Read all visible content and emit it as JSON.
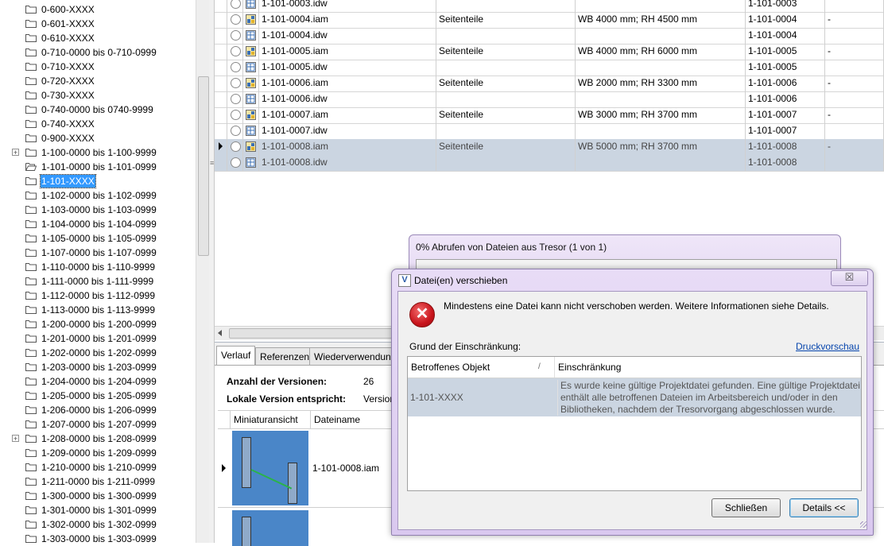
{
  "tree": {
    "items": [
      {
        "label": "0-600-XXXX",
        "expander": false
      },
      {
        "label": "0-601-XXXX",
        "expander": false
      },
      {
        "label": "0-610-XXXX",
        "expander": false
      },
      {
        "label": "0-710-0000 bis 0-710-0999",
        "expander": false
      },
      {
        "label": "0-710-XXXX",
        "expander": false
      },
      {
        "label": "0-720-XXXX",
        "expander": false
      },
      {
        "label": "0-730-XXXX",
        "expander": false
      },
      {
        "label": "0-740-0000 bis 0740-9999",
        "expander": false
      },
      {
        "label": "0-740-XXXX",
        "expander": false
      },
      {
        "label": "0-900-XXXX",
        "expander": false
      },
      {
        "label": "1-100-0000 bis 1-100-9999",
        "expander": true
      },
      {
        "label": "1-101-0000 bis 1-101-0999",
        "expander": false,
        "open": true
      },
      {
        "label": "1-101-XXXX",
        "expander": false,
        "selected": true
      },
      {
        "label": "1-102-0000 bis 1-102-0999",
        "expander": false
      },
      {
        "label": "1-103-0000 bis 1-103-0999",
        "expander": false
      },
      {
        "label": "1-104-0000 bis 1-104-0999",
        "expander": false
      },
      {
        "label": "1-105-0000 bis 1-105-0999",
        "expander": false
      },
      {
        "label": "1-107-0000 bis 1-107-0999",
        "expander": false
      },
      {
        "label": "1-110-0000 bis 1-110-9999",
        "expander": false
      },
      {
        "label": "1-111-0000 bis 1-111-9999",
        "expander": false
      },
      {
        "label": "1-112-0000 bis 1-112-0999",
        "expander": false
      },
      {
        "label": "1-113-0000 bis 1-113-9999",
        "expander": false
      },
      {
        "label": "1-200-0000 bis 1-200-0999",
        "expander": false
      },
      {
        "label": "1-201-0000 bis 1-201-0999",
        "expander": false
      },
      {
        "label": "1-202-0000 bis 1-202-0999",
        "expander": false
      },
      {
        "label": "1-203-0000 bis 1-203-0999",
        "expander": false
      },
      {
        "label": "1-204-0000 bis 1-204-0999",
        "expander": false
      },
      {
        "label": "1-205-0000 bis 1-205-0999",
        "expander": false
      },
      {
        "label": "1-206-0000 bis 1-206-0999",
        "expander": false
      },
      {
        "label": "1-207-0000 bis 1-207-0999",
        "expander": false
      },
      {
        "label": "1-208-0000 bis 1-208-0999",
        "expander": true
      },
      {
        "label": "1-209-0000 bis 1-209-0999",
        "expander": false
      },
      {
        "label": "1-210-0000 bis 1-210-0999",
        "expander": false
      },
      {
        "label": "1-211-0000 bis 1-211-0999",
        "expander": false
      },
      {
        "label": "1-300-0000 bis 1-300-0999",
        "expander": false
      },
      {
        "label": "1-301-0000 bis 1-301-0999",
        "expander": false
      },
      {
        "label": "1-302-0000 bis 1-302-0999",
        "expander": false
      },
      {
        "label": "1-303-0000 bis 1-303-0999",
        "expander": false
      }
    ]
  },
  "files": {
    "rows": [
      {
        "name": "1-101-0003.idw",
        "category": "",
        "size": "",
        "number": "1-101-0003",
        "extra": "",
        "type": "idw"
      },
      {
        "name": "1-101-0004.iam",
        "category": "Seitenteile",
        "size": "WB 4000 mm;  RH 4500 mm",
        "number": "1-101-0004",
        "extra": "-",
        "type": "iam"
      },
      {
        "name": "1-101-0004.idw",
        "category": "",
        "size": "",
        "number": "1-101-0004",
        "extra": "",
        "type": "idw"
      },
      {
        "name": "1-101-0005.iam",
        "category": "Seitenteile",
        "size": "WB 4000 mm;  RH 6000 mm",
        "number": "1-101-0005",
        "extra": "-",
        "type": "iam"
      },
      {
        "name": "1-101-0005.idw",
        "category": "",
        "size": "",
        "number": "1-101-0005",
        "extra": "",
        "type": "idw"
      },
      {
        "name": "1-101-0006.iam",
        "category": "Seitenteile",
        "size": "WB 2000 mm;  RH 3300 mm",
        "number": "1-101-0006",
        "extra": "-",
        "type": "iam"
      },
      {
        "name": "1-101-0006.idw",
        "category": "",
        "size": "",
        "number": "1-101-0006",
        "extra": "",
        "type": "idw"
      },
      {
        "name": "1-101-0007.iam",
        "category": "Seitenteile",
        "size": "WB 3000 mm; RH 3700 mm",
        "number": "1-101-0007",
        "extra": "-",
        "type": "iam"
      },
      {
        "name": "1-101-0007.idw",
        "category": "",
        "size": "",
        "number": "1-101-0007",
        "extra": "",
        "type": "idw"
      },
      {
        "name": "1-101-0008.iam",
        "category": "Seitenteile",
        "size": "WB 5000 mm;  RH 3700 mm",
        "number": "1-101-0008",
        "extra": "-",
        "type": "iam",
        "highlight": true,
        "current": true
      },
      {
        "name": "1-101-0008.idw",
        "category": "",
        "size": "",
        "number": "1-101-0008",
        "extra": "",
        "type": "idw",
        "highlight": true
      }
    ]
  },
  "details": {
    "tabs": [
      "Verlauf",
      "Referenzen",
      "Wiederverwendung"
    ],
    "versions_label": "Anzahl der Versionen:",
    "versions_value": "26",
    "local_label": "Lokale Version entspricht:",
    "local_value": "Version",
    "col_thumb": "Miniaturansicht",
    "col_filename": "Dateiname",
    "thumb_rows": [
      {
        "filename": "1-101-0008.iam"
      },
      {
        "filename": ""
      }
    ]
  },
  "progress": {
    "title": "0% Abrufen von Dateien aus Tresor (1 von 1)"
  },
  "dialog": {
    "title": "Datei(en) verschieben",
    "close_glyph": "☒",
    "message": "Mindestens eine Datei kann nicht verschoben werden. Weitere Informationen siehe Details.",
    "reason_label": "Grund der Einschränkung:",
    "print_link": "Druckvorschau",
    "columns": [
      "Betroffenes Objekt",
      "Einschränkung"
    ],
    "sort_glyph": "/",
    "rows": [
      {
        "object": "1-101-XXXX",
        "restriction": "Es wurde keine gültige Projektdatei gefunden. Eine gültige Projektdatei enthält alle betroffenen Dateien im Arbeitsbereich und/oder in den Bibliotheken, nachdem der Tresorvorgang abgeschlossen wurde."
      }
    ],
    "close_button": "Schließen",
    "details_button": "Details <<"
  }
}
